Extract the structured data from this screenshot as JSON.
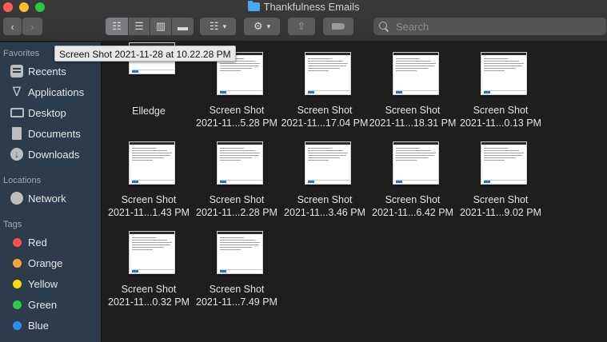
{
  "window": {
    "title": "Thankfulness Emails"
  },
  "toolbar": {
    "back_icon": "chevron-left-icon",
    "forward_icon": "chevron-right-icon",
    "view_modes": [
      "icon-view-icon",
      "list-view-icon",
      "column-view-icon",
      "gallery-view-icon"
    ],
    "group_icon": "group-by-icon",
    "action_icon": "gear-icon",
    "share_icon": "share-icon",
    "tag_icon": "tag-icon",
    "search": {
      "placeholder": "Search",
      "value": ""
    }
  },
  "tooltip": {
    "text": "Screen Shot 2021-11-28 at 10.22.28 PM"
  },
  "sidebar": {
    "favorites_header": "Favorites",
    "favorites": [
      {
        "label": "Recents",
        "icon": "recents-icon"
      },
      {
        "label": "Applications",
        "icon": "applications-icon"
      },
      {
        "label": "Desktop",
        "icon": "desktop-icon"
      },
      {
        "label": "Documents",
        "icon": "documents-icon"
      },
      {
        "label": "Downloads",
        "icon": "downloads-icon"
      }
    ],
    "locations_header": "Locations",
    "locations": [
      {
        "label": "Network",
        "icon": "network-icon"
      }
    ],
    "tags_header": "Tags",
    "tags": [
      {
        "label": "Red",
        "color": "#fe4f4f"
      },
      {
        "label": "Orange",
        "color": "#fea43c"
      },
      {
        "label": "Yellow",
        "color": "#fdd90f"
      },
      {
        "label": "Green",
        "color": "#2ec84a"
      },
      {
        "label": "Blue",
        "color": "#2d8ef5"
      }
    ]
  },
  "files": [
    {
      "line1": "Elledge",
      "line2": ""
    },
    {
      "line1": "Screen Shot",
      "line2": "2021-11...5.28 PM"
    },
    {
      "line1": "Screen Shot",
      "line2": "2021-11...17.04 PM"
    },
    {
      "line1": "Screen Shot",
      "line2": "2021-11...18.31 PM"
    },
    {
      "line1": "Screen Shot",
      "line2": "2021-11...0.13 PM"
    },
    {
      "line1": "Screen Shot",
      "line2": "2021-11...1.43 PM"
    },
    {
      "line1": "Screen Shot",
      "line2": "2021-11...2.28 PM"
    },
    {
      "line1": "Screen Shot",
      "line2": "2021-11...3.46 PM"
    },
    {
      "line1": "Screen Shot",
      "line2": "2021-11...6.42 PM"
    },
    {
      "line1": "Screen Shot",
      "line2": "2021-11...9.02 PM"
    },
    {
      "line1": "Screen Shot",
      "line2": "2021-11...0.32 PM"
    },
    {
      "line1": "Screen Shot",
      "line2": "2021-11...7.49 PM"
    }
  ]
}
